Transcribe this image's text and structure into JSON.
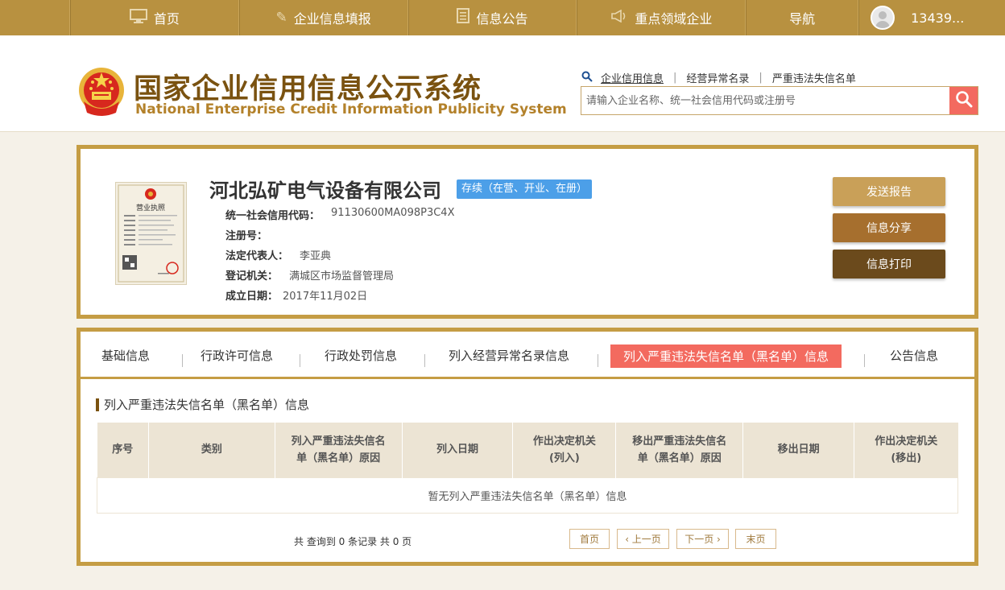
{
  "topnav": {
    "items": [
      {
        "label": "首页",
        "icon": "monitor-icon"
      },
      {
        "label": "企业信息填报",
        "icon": "pen-icon"
      },
      {
        "label": "信息公告",
        "icon": "document-icon"
      },
      {
        "label": "重点领域企业",
        "icon": "megaphone-icon"
      },
      {
        "label": "导航",
        "icon": ""
      }
    ],
    "user": "13439..."
  },
  "header": {
    "title_cn": "国家企业信用信息公示系统",
    "title_en": "National Enterprise Credit Information Publicity System",
    "quick_links": [
      "企业信用信息",
      "经营异常名录",
      "严重违法失信名单"
    ],
    "search_placeholder": "请输入企业名称、统一社会信用代码或注册号"
  },
  "company": {
    "name": "河北弘矿电气设备有限公司",
    "status": "存续（在营、开业、在册）",
    "license_title": "营业执照",
    "fields": [
      {
        "label": "统一社会信用代码：",
        "value": "91130600MA098P3C4X"
      },
      {
        "label": "注册号：",
        "value": ""
      },
      {
        "label": "法定代表人：",
        "value": "李亚典"
      },
      {
        "label": "登记机关：",
        "value": "满城区市场监督管理局"
      },
      {
        "label": "成立日期：",
        "value": "2017年11月02日"
      }
    ],
    "actions": [
      "发送报告",
      "信息分享",
      "信息打印"
    ],
    "action_colors": [
      "#c9a058",
      "#a66f2e",
      "#6b4a1c"
    ]
  },
  "tabs": {
    "items": [
      "基础信息",
      "行政许可信息",
      "行政处罚信息",
      "列入经营异常名录信息",
      "列入严重违法失信名单（黑名单）信息",
      "公告信息"
    ],
    "active_index": 4
  },
  "section": {
    "title": "列入严重违法失信名单（黑名单）信息",
    "columns": [
      "序号",
      "类别",
      "列入严重违法失信名单（黑名单）原因",
      "列入日期",
      "作出决定机关(列入)",
      "移出严重违法失信名单（黑名单）原因",
      "移出日期",
      "作出决定机关(移出)"
    ],
    "empty_text": "暂无列入严重违法失信名单（黑名单）信息"
  },
  "pager": {
    "info": "共 查询到 0 条记录 共 0 页",
    "first": "首页",
    "prev": "‹ 上一页",
    "next": "下一页 ›",
    "last": "末页"
  },
  "colors": {
    "gold": "#b89140",
    "brown": "#7a5210",
    "accent_red": "#f36a5f",
    "status_blue": "#4c9fe8"
  }
}
